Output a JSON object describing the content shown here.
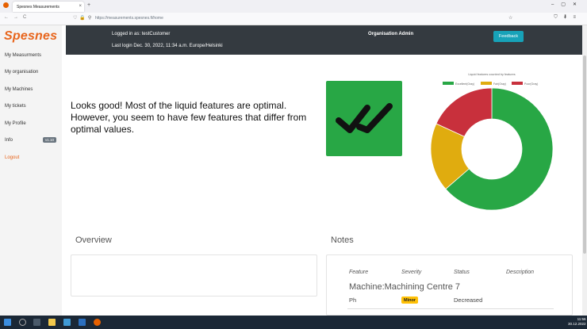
{
  "browser": {
    "tab_title": "Spesnes Measurements",
    "tab_close": "×",
    "new_tab": "+",
    "window_controls": "–▢✕",
    "nav_buttons": "←→C",
    "url": "https://measurements.spesnes.fi/home",
    "left_icons": "♡🔒⚲",
    "star": "☆",
    "right_icons": "⛉⬇≡"
  },
  "sidebar": {
    "logo": "Spesnes",
    "items": [
      {
        "label": "My Measurments"
      },
      {
        "label": "My organisation"
      },
      {
        "label": "My Machines"
      },
      {
        "label": "My tickets"
      },
      {
        "label": "My Profile"
      },
      {
        "label": "Info",
        "badge": "v1.10"
      },
      {
        "label": "Logout"
      }
    ],
    "logout_color": "#e8651c"
  },
  "header": {
    "logged_in": "Logged in as: testCustomer",
    "last_login": "Last login Dec. 30, 2022, 11:34 a.m. Europe/Helsinki",
    "org_admin": "Organisation Admin",
    "feedback_label": "Feedback"
  },
  "status": {
    "message": "Looks good! Most of the liquid features are optimal. However, you seem to have few features that differ from optimal values.",
    "icon": "double-check-icon",
    "box_color": "#28a745"
  },
  "chart_data": {
    "type": "pie",
    "title": "Liquid features counted by features",
    "categories": [
      "Excellent(Gray)",
      "Fair(Gray)",
      "Poor(Gray)"
    ],
    "values": [
      7,
      2,
      2
    ],
    "colors": [
      "#28a745",
      "#e0ac0f",
      "#c8303c"
    ],
    "donut": true,
    "legend_position": "top"
  },
  "overview": {
    "title": "Overview"
  },
  "notes": {
    "title": "Notes",
    "columns": [
      "Feature",
      "Severity",
      "Status",
      "Description"
    ],
    "machine": "Machine:Machining Centre 7",
    "rows": [
      {
        "feature": "Ph",
        "severity": "Minor",
        "status": "Decreased",
        "description": ""
      }
    ]
  },
  "taskbar": {
    "time": "11:56",
    "date": "30.12.2022"
  }
}
